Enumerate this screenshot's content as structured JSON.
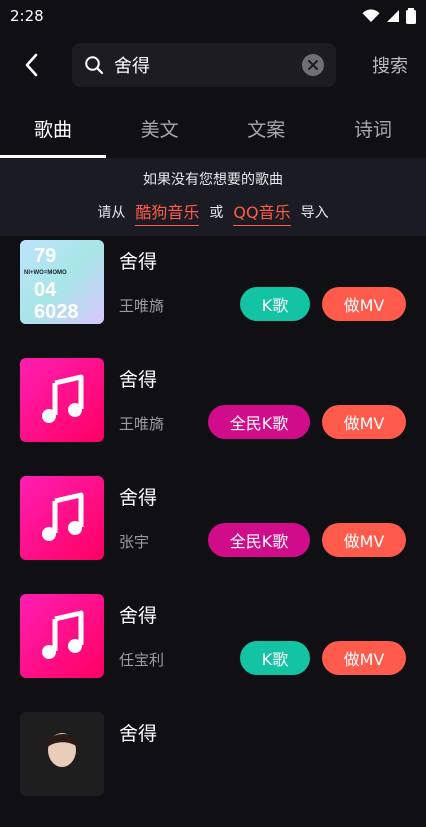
{
  "status": {
    "time": "2:28"
  },
  "search": {
    "query": "舍得",
    "submit_label": "搜索"
  },
  "tabs": [
    {
      "label": "歌曲",
      "active": true
    },
    {
      "label": "美文",
      "active": false
    },
    {
      "label": "文案",
      "active": false
    },
    {
      "label": "诗词",
      "active": false
    }
  ],
  "notice": {
    "line1": "如果没有您想要的歌曲",
    "prefix": "请从",
    "source1": "酷狗音乐",
    "middle": "或",
    "source2": "QQ音乐",
    "suffix": "导入"
  },
  "album_art": {
    "text_top": "79",
    "text_mid": "04",
    "text_bottom": "6028",
    "text_small": "NI+WO=MOMO"
  },
  "songs": [
    {
      "title": "舍得",
      "artist": "王唯旖",
      "k_label": "K歌",
      "mv_label": "做MV",
      "cover": "album"
    },
    {
      "title": "舍得",
      "artist": "王唯旖",
      "k_label": "全民K歌",
      "mv_label": "做MV",
      "cover": "music-note"
    },
    {
      "title": "舍得",
      "artist": "张宇",
      "k_label": "全民K歌",
      "mv_label": "做MV",
      "cover": "music-note"
    },
    {
      "title": "舍得",
      "artist": "任宝利",
      "k_label": "K歌",
      "mv_label": "做MV",
      "cover": "music-note"
    },
    {
      "title": "舍得",
      "artist": "",
      "k_label": "",
      "mv_label": "",
      "cover": "photo"
    }
  ],
  "colors": {
    "k": "#14c3a4",
    "quanmin": "#d00c8a",
    "mv": "#ff5b4c",
    "link": "#ff5a4a"
  }
}
